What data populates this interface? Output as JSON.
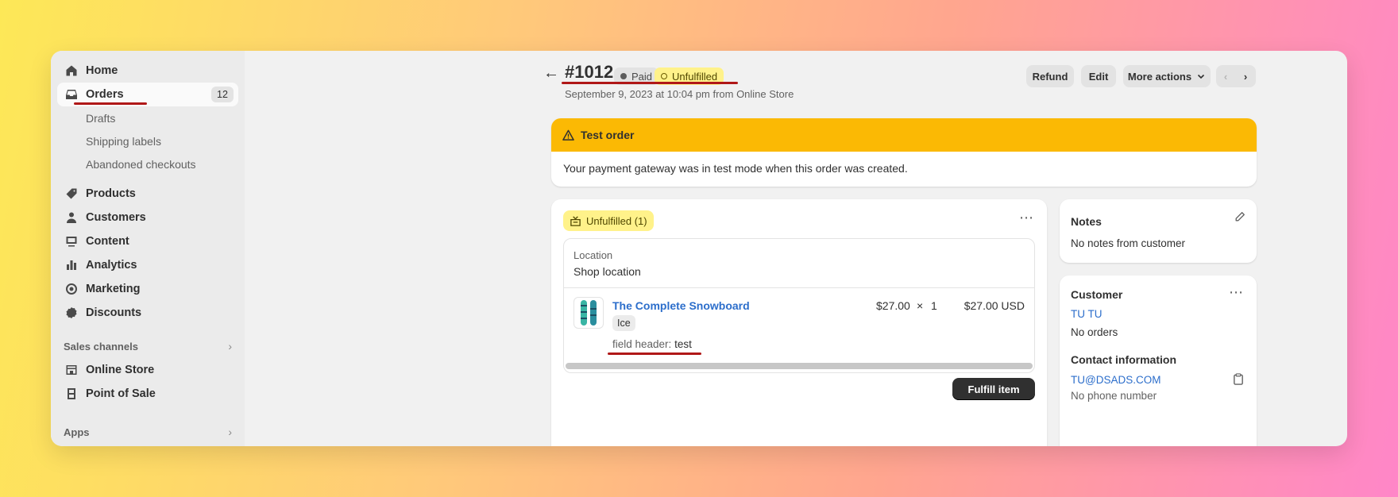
{
  "sidebar": {
    "items": [
      {
        "label": "Home",
        "icon": "home-icon"
      },
      {
        "label": "Orders",
        "icon": "inbox-icon",
        "badge": "12"
      },
      {
        "label": "Drafts"
      },
      {
        "label": "Shipping labels"
      },
      {
        "label": "Abandoned checkouts"
      },
      {
        "label": "Products",
        "icon": "tag-icon"
      },
      {
        "label": "Customers",
        "icon": "person-icon"
      },
      {
        "label": "Content",
        "icon": "content-icon"
      },
      {
        "label": "Analytics",
        "icon": "bar-chart-icon"
      },
      {
        "label": "Marketing",
        "icon": "target-icon"
      },
      {
        "label": "Discounts",
        "icon": "discount-icon"
      }
    ],
    "sales_channels": {
      "label": "Sales channels",
      "items": [
        {
          "label": "Online Store",
          "icon": "store-icon"
        },
        {
          "label": "Point of Sale",
          "icon": "pos-icon"
        }
      ]
    },
    "apps_label": "Apps"
  },
  "header": {
    "back": "←",
    "order_number": "#1012",
    "paid_badge": "Paid",
    "unfulfilled_badge": "Unfulfilled",
    "subtitle": "September 9, 2023 at 10:04 pm from Online Store",
    "refund": "Refund",
    "edit": "Edit",
    "more_actions": "More actions",
    "prev": "‹",
    "next": "›"
  },
  "banner": {
    "title": "Test order",
    "message": "Your payment gateway was in test mode when this order was created.",
    "color": "#fbb904"
  },
  "fulfillment": {
    "status": "Unfulfilled (1)",
    "location_label": "Location",
    "location_value": "Shop location",
    "item": {
      "name": "The Complete Snowboard",
      "variant": "Ice",
      "field_label": "field header:",
      "field_value": "test",
      "price": "$27.00",
      "times": "×",
      "quantity": "1",
      "total": "$27.00 USD"
    },
    "fulfill_button": "Fulfill item"
  },
  "notes": {
    "title": "Notes",
    "text": "No notes from customer"
  },
  "customer": {
    "title": "Customer",
    "name": "TU TU",
    "orders": "No orders",
    "contact_title": "Contact information",
    "email": "TU@DSADS.COM",
    "phone": "No phone number"
  },
  "colors": {
    "accent_link": "#2c6ecb",
    "warning_badge": "#fff28a",
    "annotation": "#b01818"
  }
}
